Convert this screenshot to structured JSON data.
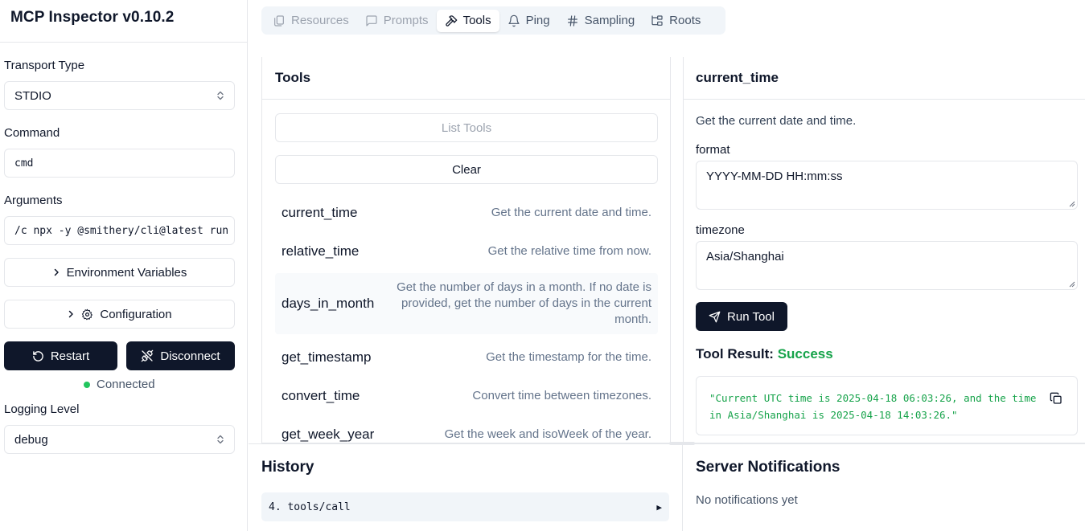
{
  "app": {
    "title": "MCP Inspector v0.10.2"
  },
  "sidebar": {
    "transport_label": "Transport Type",
    "transport_value": "STDIO",
    "command_label": "Command",
    "command_value": "cmd",
    "arguments_label": "Arguments",
    "arguments_value": "/c npx -y @smithery/cli@latest run",
    "env_button": "Environment Variables",
    "config_button": "Configuration",
    "restart_button": "Restart",
    "disconnect_button": "Disconnect",
    "status_text": "Connected",
    "logging_label": "Logging Level",
    "logging_value": "debug"
  },
  "tabs": [
    {
      "label": "Resources",
      "state": "disabled"
    },
    {
      "label": "Prompts",
      "state": "disabled"
    },
    {
      "label": "Tools",
      "state": "active"
    },
    {
      "label": "Ping",
      "state": "normal"
    },
    {
      "label": "Sampling",
      "state": "normal"
    },
    {
      "label": "Roots",
      "state": "normal"
    }
  ],
  "tools_panel": {
    "title": "Tools",
    "list_button": "List Tools",
    "clear_button": "Clear",
    "items": [
      {
        "name": "current_time",
        "desc": "Get the current date and time."
      },
      {
        "name": "relative_time",
        "desc": "Get the relative time from now."
      },
      {
        "name": "days_in_month",
        "desc": "Get the number of days in a month. If no date is provided, get the number of days in the current month."
      },
      {
        "name": "get_timestamp",
        "desc": "Get the timestamp for the time."
      },
      {
        "name": "convert_time",
        "desc": "Convert time between timezones."
      },
      {
        "name": "get_week_year",
        "desc": "Get the week and isoWeek of the year."
      }
    ]
  },
  "detail": {
    "title": "current_time",
    "description": "Get the current date and time.",
    "format_label": "format",
    "format_value": "YYYY-MM-DD HH:mm:ss",
    "timezone_label": "timezone",
    "timezone_value": "Asia/Shanghai",
    "run_button": "Run Tool",
    "result_label": "Tool Result: ",
    "result_status": "Success",
    "result_text": "\"Current UTC time is 2025-04-18 06:03:26, and the time in Asia/Shanghai is 2025-04-18 14:03:26.\""
  },
  "history": {
    "title": "History",
    "items": [
      {
        "label": "4. tools/call"
      }
    ]
  },
  "notifications": {
    "title": "Server Notifications",
    "empty_text": "No notifications yet"
  },
  "colors": {
    "primary": "#0f172a",
    "success": "#16a34a",
    "status_dot": "#22c55e",
    "border": "#e5e7eb"
  }
}
